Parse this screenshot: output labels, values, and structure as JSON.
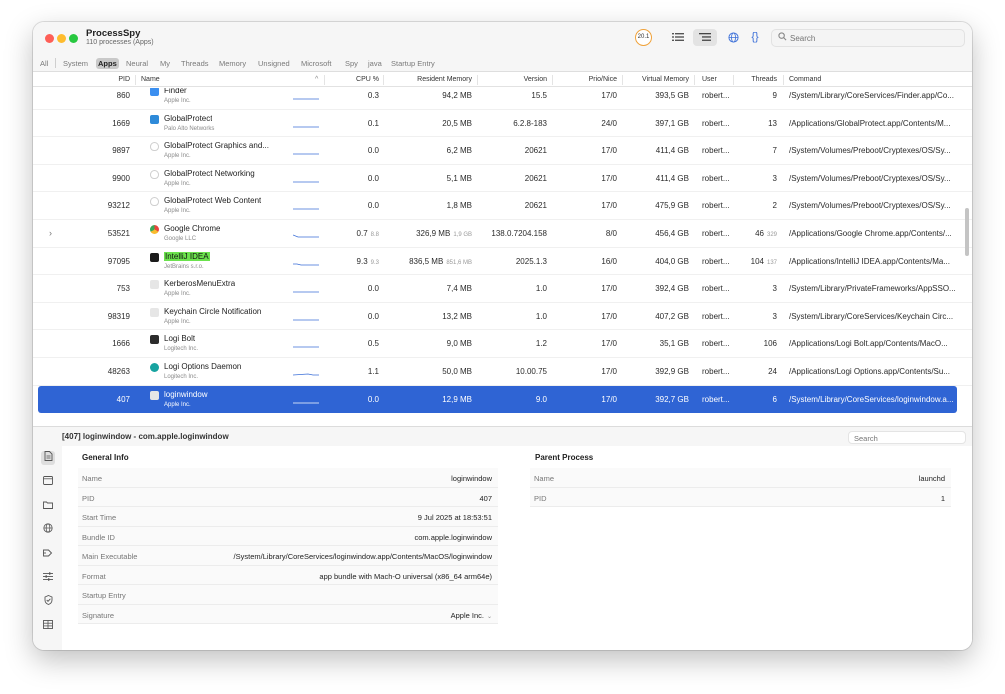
{
  "app": {
    "title": "ProcessSpy",
    "subtitle": "110 processes (Apps)",
    "cpu_badge": "20.1"
  },
  "search": {
    "placeholder": "Search"
  },
  "filters": [
    "All",
    "System",
    "Apps",
    "Neural",
    "My",
    "Threads",
    "Memory",
    "Unsigned",
    "Microsoft",
    "Spy",
    "java",
    "Startup Entry"
  ],
  "active_filter": "Apps",
  "columns": {
    "pid": "PID",
    "name": "Name",
    "cpu": "CPU %",
    "mem": "Resident Memory",
    "version": "Version",
    "prio": "Prio/Nice",
    "vmem": "Virtual Memory",
    "user": "User",
    "threads": "Threads",
    "command": "Command"
  },
  "rows": [
    {
      "pid": "860",
      "name": "Finder",
      "vendor": "Apple Inc.",
      "cpu": "0.3",
      "cpu_sub": "",
      "mem": "94,2 MB",
      "mem_sub": "",
      "version": "15.5",
      "prio": "17/0",
      "vmem": "393,5 GB",
      "user": "robert...",
      "threads": "9",
      "threads_sub": "",
      "command": "/System/Library/CoreServices/Finder.app/Co...",
      "icon": "finder-icon",
      "icon_color": "#3b8ff0"
    },
    {
      "pid": "1669",
      "name": "GlobalProtect",
      "vendor": "Palo Alto Networks",
      "cpu": "0.1",
      "cpu_sub": "",
      "mem": "20,5 MB",
      "mem_sub": "",
      "version": "6.2.8-183",
      "prio": "24/0",
      "vmem": "397,1 GB",
      "user": "robert...",
      "threads": "13",
      "threads_sub": "",
      "command": "/Applications/GlobalProtect.app/Contents/M...",
      "icon": "globalprotect-icon",
      "icon_color": "#2e8ad9"
    },
    {
      "pid": "9897",
      "name": "GlobalProtect Graphics and...",
      "vendor": "Apple Inc.",
      "cpu": "0.0",
      "cpu_sub": "",
      "mem": "6,2 MB",
      "mem_sub": "",
      "version": "20621",
      "prio": "17/0",
      "vmem": "411,4 GB",
      "user": "robert...",
      "threads": "7",
      "threads_sub": "",
      "command": "/System/Volumes/Preboot/Cryptexes/OS/Sy...",
      "icon": "shield-outline-icon",
      "icon_color": "#d8d8d8"
    },
    {
      "pid": "9900",
      "name": "GlobalProtect Networking",
      "vendor": "Apple Inc.",
      "cpu": "0.0",
      "cpu_sub": "",
      "mem": "5,1 MB",
      "mem_sub": "",
      "version": "20621",
      "prio": "17/0",
      "vmem": "411,4 GB",
      "user": "robert...",
      "threads": "3",
      "threads_sub": "",
      "command": "/System/Volumes/Preboot/Cryptexes/OS/Sy...",
      "icon": "shield-outline-icon",
      "icon_color": "#d8d8d8"
    },
    {
      "pid": "93212",
      "name": "GlobalProtect Web Content",
      "vendor": "Apple Inc.",
      "cpu": "0.0",
      "cpu_sub": "",
      "mem": "1,8 MB",
      "mem_sub": "",
      "version": "20621",
      "prio": "17/0",
      "vmem": "475,9 GB",
      "user": "robert...",
      "threads": "2",
      "threads_sub": "",
      "command": "/System/Volumes/Preboot/Cryptexes/OS/Sy...",
      "icon": "shield-outline-icon",
      "icon_color": "#d8d8d8"
    },
    {
      "pid": "53521",
      "name": "Google Chrome",
      "vendor": "Google LLC",
      "cpu": "0.7",
      "cpu_sub": "8.8",
      "mem": "326,9 MB",
      "mem_sub": "1,9 GB",
      "version": "138.0.7204.158",
      "prio": "8/0",
      "vmem": "456,4 GB",
      "user": "robert...",
      "threads": "46",
      "threads_sub": "329",
      "command": "/Applications/Google Chrome.app/Contents/...",
      "icon": "chrome-icon",
      "icon_color": "#e8453c",
      "expandable": true
    },
    {
      "pid": "97095",
      "name": "IntelliJ IDEA",
      "vendor": "JetBrains s.r.o.",
      "cpu": "9.3",
      "cpu_sub": "9.3",
      "mem": "836,5 MB",
      "mem_sub": "851,6 MB",
      "version": "2025.1.3",
      "prio": "16/0",
      "vmem": "404,0 GB",
      "user": "robert...",
      "threads": "104",
      "threads_sub": "137",
      "command": "/Applications/IntelliJ IDEA.app/Contents/Ma...",
      "icon": "intellij-icon",
      "icon_color": "#1b1b1b",
      "highlight": true
    },
    {
      "pid": "753",
      "name": "KerberosMenuExtra",
      "vendor": "Apple Inc.",
      "cpu": "0.0",
      "cpu_sub": "",
      "mem": "7,4 MB",
      "mem_sub": "",
      "version": "1.0",
      "prio": "17/0",
      "vmem": "392,4 GB",
      "user": "robert...",
      "threads": "3",
      "threads_sub": "",
      "command": "/System/Library/PrivateFrameworks/AppSSO...",
      "icon": "generic-app-icon",
      "icon_color": "#e6e6e6"
    },
    {
      "pid": "98319",
      "name": "Keychain Circle Notification",
      "vendor": "Apple Inc.",
      "cpu": "0.0",
      "cpu_sub": "",
      "mem": "13,2 MB",
      "mem_sub": "",
      "version": "1.0",
      "prio": "17/0",
      "vmem": "407,2 GB",
      "user": "robert...",
      "threads": "3",
      "threads_sub": "",
      "command": "/System/Library/CoreServices/Keychain Circ...",
      "icon": "generic-app-icon",
      "icon_color": "#e6e6e6"
    },
    {
      "pid": "1666",
      "name": "Logi Bolt",
      "vendor": "Logitech Inc.",
      "cpu": "0.5",
      "cpu_sub": "",
      "mem": "9,0 MB",
      "mem_sub": "",
      "version": "1.2",
      "prio": "17/0",
      "vmem": "35,1 GB",
      "user": "robert...",
      "threads": "106",
      "threads_sub": "",
      "command": "/Applications/Logi Bolt.app/Contents/MacO...",
      "icon": "logi-bolt-icon",
      "icon_color": "#2c2c2c"
    },
    {
      "pid": "48263",
      "name": "Logi Options Daemon",
      "vendor": "Logitech Inc.",
      "cpu": "1.1",
      "cpu_sub": "",
      "mem": "50,0 MB",
      "mem_sub": "",
      "version": "10.00.75",
      "prio": "17/0",
      "vmem": "392,9 GB",
      "user": "robert...",
      "threads": "24",
      "threads_sub": "",
      "command": "/Applications/Logi Options.app/Contents/Su...",
      "icon": "logi-options-icon",
      "icon_color": "#17a3a0"
    },
    {
      "pid": "407",
      "name": "loginwindow",
      "vendor": "Apple Inc.",
      "cpu": "0.0",
      "cpu_sub": "",
      "mem": "12,9 MB",
      "mem_sub": "",
      "version": "9.0",
      "prio": "17/0",
      "vmem": "392,7 GB",
      "user": "robert...",
      "threads": "6",
      "threads_sub": "",
      "command": "/System/Library/CoreServices/loginwindow.a...",
      "icon": "generic-app-icon",
      "icon_color": "#e6e6e6",
      "selected": true
    }
  ],
  "detail": {
    "title": "[407] loginwindow - com.apple.loginwindow",
    "search_placeholder": "Search",
    "general_info": {
      "title": "General Info",
      "fields": [
        {
          "key": "Name",
          "value": "loginwindow"
        },
        {
          "key": "PID",
          "value": "407"
        },
        {
          "key": "Start Time",
          "value": "9 Jul 2025 at 18:53:51"
        },
        {
          "key": "Bundle ID",
          "value": "com.apple.loginwindow"
        },
        {
          "key": "Main Executable",
          "value": "/System/Library/CoreServices/loginwindow.app/Contents/MacOS/loginwindow"
        },
        {
          "key": "Format",
          "value": "app bundle with Mach-O universal (x86_64 arm64e)"
        },
        {
          "key": "Startup Entry",
          "value": ""
        },
        {
          "key": "Signature",
          "value": "Apple Inc."
        }
      ]
    },
    "parent_process": {
      "title": "Parent Process",
      "fields": [
        {
          "key": "Name",
          "value": "launchd"
        },
        {
          "key": "PID",
          "value": "1"
        }
      ]
    },
    "sidebar_icons": [
      "document-icon",
      "window-icon",
      "folder-icon",
      "globe-icon",
      "plug-icon",
      "sliders-icon",
      "shield-check-icon",
      "table-icon"
    ]
  }
}
